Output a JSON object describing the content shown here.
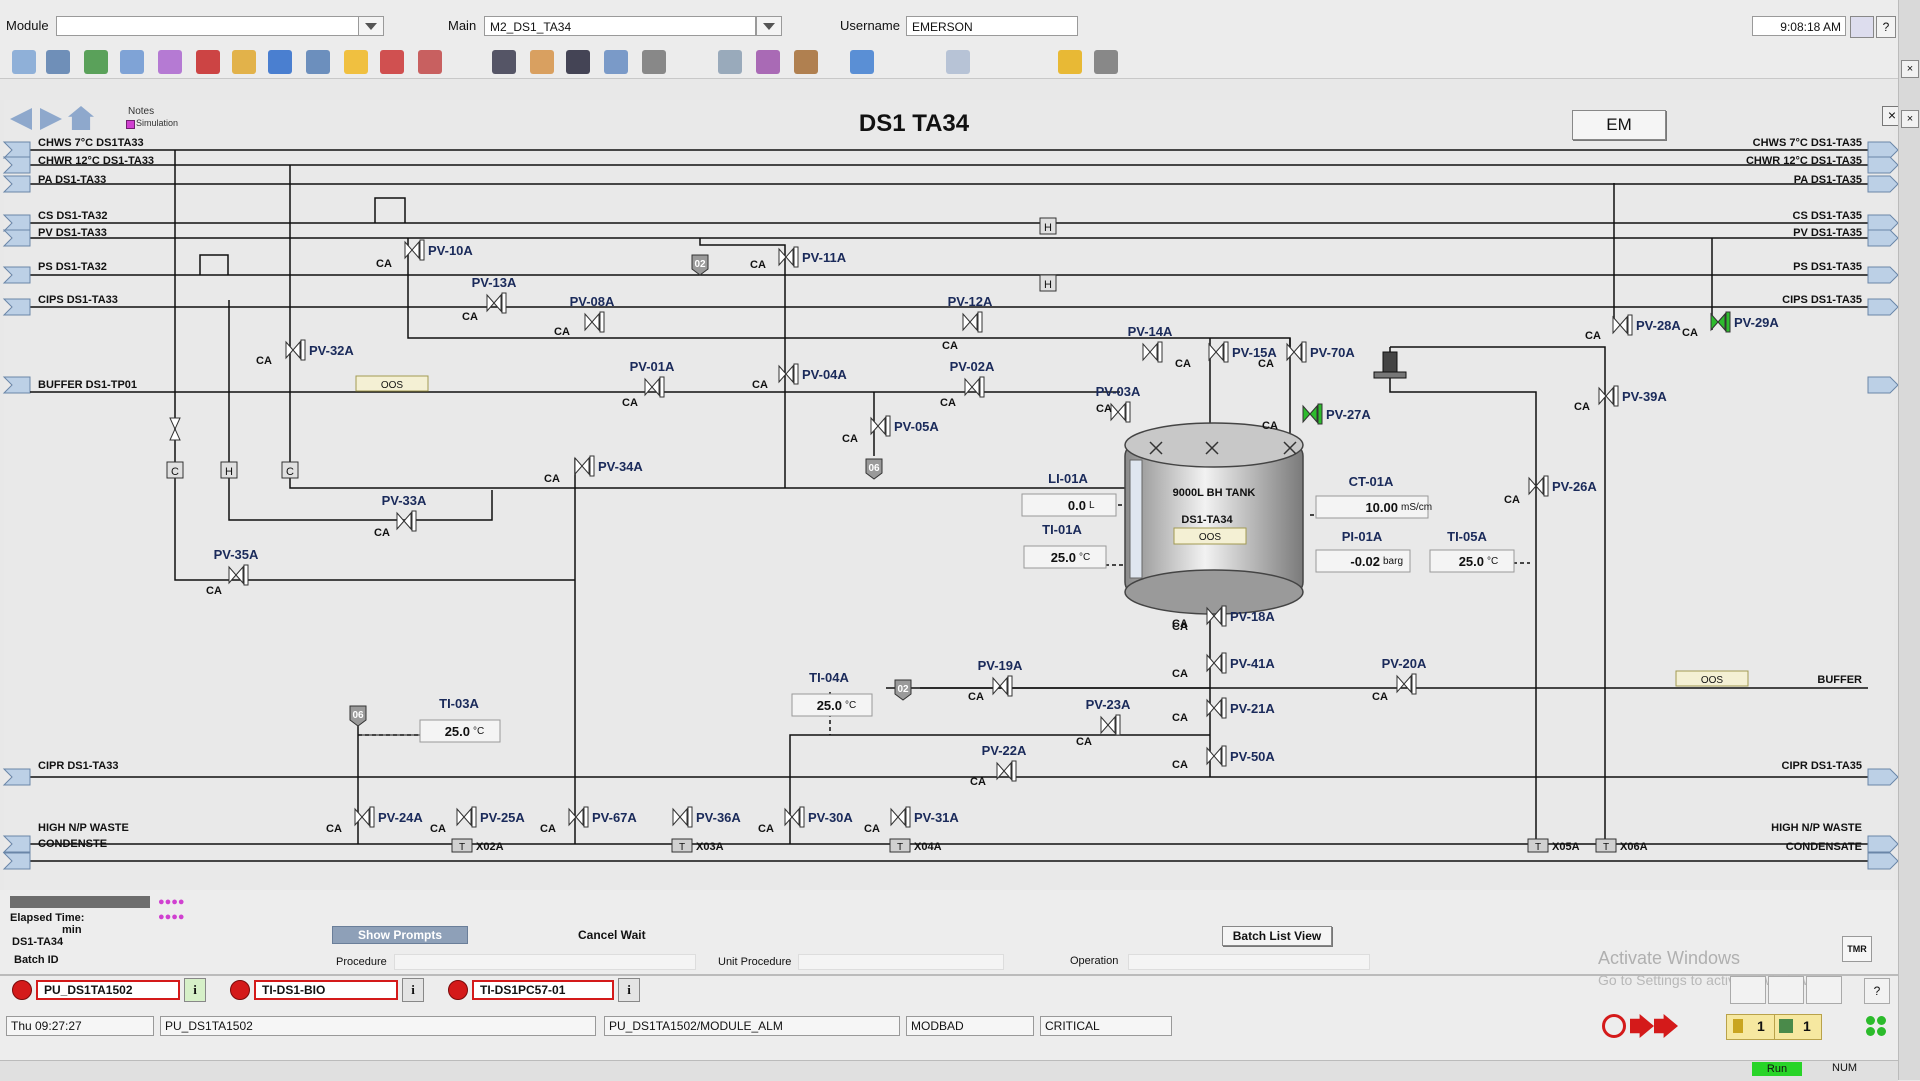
{
  "header": {
    "module_label": "Module",
    "module_value": "",
    "main_label": "Main",
    "main_value": "M2_DS1_TA34",
    "username_label": "Username",
    "username_value": "EMERSON",
    "clock": "9:08:18 AM"
  },
  "nav": {
    "notes_label": "Notes",
    "simulation_label": "Simulation"
  },
  "display": {
    "title": "DS1 TA34",
    "em_button": "EM"
  },
  "headers_left": [
    "CHWS 7°C DS1TA33",
    "CHWR 12°C DS1-TA33",
    "PA DS1-TA33",
    "CS DS1-TA32",
    "PV DS1-TA33",
    "PS DS1-TA32",
    "CIPS DS1-TA33",
    "BUFFER DS1-TP01",
    "CIPR DS1-TA33",
    "HIGH N/P WASTE",
    "CONDENSTE"
  ],
  "headers_right": [
    "CHWS 7°C DS1-TA35",
    "CHWR 12°C DS1-TA35",
    "PA DS1-TA35",
    "CS DS1-TA35",
    "PV DS1-TA35",
    "PS DS1-TA35",
    "CIPS DS1-TA35",
    "BUFFER",
    "CIPR DS1-TA35",
    "HIGH N/P WASTE",
    "CONDENSATE"
  ],
  "valves": [
    "PV-10A",
    "PV-11A",
    "PV-13A",
    "PV-08A",
    "PV-12A",
    "PV-29A",
    "PV-28A",
    "PV-32A",
    "PV-01A",
    "PV-04A",
    "PV-02A",
    "PV-14A",
    "PV-15A",
    "PV-70A",
    "PV-39A",
    "PV-03A",
    "PV-27A",
    "PV-05A",
    "PV-34A",
    "PV-33A",
    "PV-26A",
    "PV-35A",
    "PV-18A",
    "PV-19A",
    "PV-41A",
    "PV-20A",
    "PV-23A",
    "PV-21A",
    "PV-22A",
    "PV-50A",
    "PV-24A",
    "PV-25A",
    "PV-67A",
    "PV-36A",
    "PV-30A",
    "PV-31A"
  ],
  "ca_label": "CA",
  "oos_label": "OOS",
  "tank": {
    "line1": "9000L BH TANK",
    "line2": "DS1-TA34",
    "status": "OOS"
  },
  "instruments": {
    "li01a": {
      "tag": "LI-01A",
      "value": "0.0",
      "unit": "L"
    },
    "ti01a": {
      "tag": "TI-01A",
      "value": "25.0",
      "unit": "°C"
    },
    "ct01a": {
      "tag": "CT-01A",
      "value": "10.00",
      "unit": "mS/cm"
    },
    "pi01a": {
      "tag": "PI-01A",
      "value": "-0.02",
      "unit": "barg"
    },
    "ti05a": {
      "tag": "TI-05A",
      "value": "25.0",
      "unit": "°C"
    },
    "ti04a": {
      "tag": "TI-04A",
      "value": "25.0",
      "unit": "°C"
    },
    "ti03a": {
      "tag": "TI-03A",
      "value": "25.0",
      "unit": "°C"
    }
  },
  "sample_points": [
    "02",
    "06",
    "02",
    "06"
  ],
  "junction_letters": [
    "C",
    "H",
    "C",
    "H",
    "H"
  ],
  "traps": [
    "X02A",
    "X03A",
    "X04A",
    "X05A",
    "X06A"
  ],
  "trap_letter": "T",
  "batch": {
    "elapsed_label": "Elapsed Time:",
    "elapsed_value": "min",
    "unit_tag": "DS1-TA34",
    "batch_id_label": "Batch ID",
    "show_prompts": "Show Prompts",
    "cancel_wait": "Cancel Wait",
    "batch_list_view": "Batch List View",
    "procedure_label": "Procedure",
    "unit_procedure_label": "Unit Procedure",
    "operation_label": "Operation",
    "dots": "●●●●"
  },
  "watermark": {
    "title": "Activate Windows",
    "subtitle": "Go to Settings to activate Windows."
  },
  "tmr_label": "TMR",
  "alarms": [
    {
      "tag": "PU_DS1TA1502",
      "info": "i"
    },
    {
      "tag": "TI-DS1-BIO",
      "info": "i"
    },
    {
      "tag": "TI-DS1PC57-01",
      "info": "i"
    }
  ],
  "statusbar": {
    "datetime": "Thu 09:27:27",
    "unit": "PU_DS1TA1502",
    "alarm_path": "PU_DS1TA1502/MODULE_ALM",
    "alarm_type": "MODBAD",
    "priority": "CRITICAL",
    "count1": "1",
    "count2": "1",
    "run": "Run",
    "num": "NUM"
  },
  "side": {
    "help": "?"
  },
  "colors": {
    "oos_fill": "#f4f0d4",
    "active_valve": "#2dbb2d",
    "alarm_red": "#d41a1a",
    "run_green": "#28d428"
  }
}
